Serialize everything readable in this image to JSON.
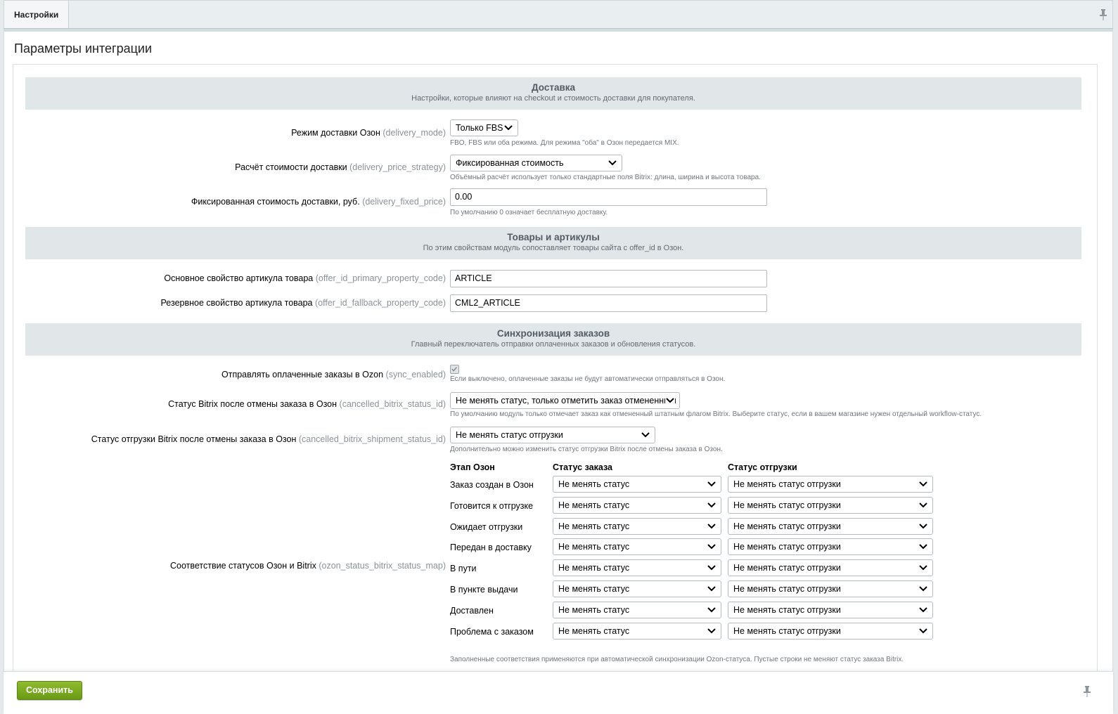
{
  "tabs": {
    "settings": "Настройки"
  },
  "page_title": "Параметры интеграции",
  "sections": {
    "delivery": {
      "title": "Доставка",
      "subtitle": "Настройки, которые влияют на checkout и стоимость доставки для покупателя."
    },
    "products": {
      "title": "Товары и артикулы",
      "subtitle": "По этим свойствам модуль сопоставляет товары сайта с offer_id в Озон."
    },
    "orders": {
      "title": "Синхронизация заказов",
      "subtitle": "Главный переключатель отправки оплаченных заказов и обновления статусов."
    }
  },
  "fields": {
    "delivery_mode": {
      "label": "Режим доставки Озон",
      "code": "(delivery_mode)",
      "value": "Только FBS",
      "hint": "FBO, FBS или оба режима. Для режима \"оба\" в Озон передается MIX."
    },
    "delivery_price_strategy": {
      "label": "Расчёт стоимости доставки",
      "code": "(delivery_price_strategy)",
      "value": "Фиксированная стоимость",
      "hint": "Объёмный расчёт использует только стандартные поля Bitrix: длина, ширина и высота товара."
    },
    "delivery_fixed_price": {
      "label": "Фиксированная стоимость доставки, руб.",
      "code": "(delivery_fixed_price)",
      "value": "0.00",
      "hint": "По умолчанию 0 означает бесплатную доставку."
    },
    "offer_id_primary_property_code": {
      "label": "Основное свойство артикула товара",
      "code": "(offer_id_primary_property_code)",
      "value": "ARTICLE"
    },
    "offer_id_fallback_property_code": {
      "label": "Резервное свойство артикула товара",
      "code": "(offer_id_fallback_property_code)",
      "value": "CML2_ARTICLE"
    },
    "sync_enabled": {
      "label": "Отправлять оплаченные заказы в Ozon",
      "code": "(sync_enabled)",
      "checked": true,
      "hint": "Если выключено, оплаченные заказы не будут автоматически отправляться в Озон."
    },
    "cancelled_bitrix_status_id": {
      "label": "Статус Bitrix после отмены заказа в Озон",
      "code": "(cancelled_bitrix_status_id)",
      "value": "Не менять статус, только отметить заказ отмененным",
      "hint": "По умолчанию модуль только отмечает заказ как отмененный штатным флагом Bitrix. Выберите статус, если в вашем магазине нужен отдельный workflow-статус."
    },
    "cancelled_bitrix_shipment_status_id": {
      "label": "Статус отгрузки Bitrix после отмены заказа в Озон",
      "code": "(cancelled_bitrix_shipment_status_id)",
      "value": "Не менять статус отгрузки",
      "hint": "Дополнительно можно изменить статус отгрузки Bitrix после отмены заказа в Озон."
    },
    "ozon_status_bitrix_status_map": {
      "label": "Соответствие статусов Озон и Bitrix",
      "code": "(ozon_status_bitrix_status_map)",
      "hint": "Заполненные соответствия применяются при автоматической синхронизации Ozon-статуса. Пустые строки не меняют статус заказа Bitrix."
    }
  },
  "status_map": {
    "headers": {
      "stage": "Этап Озон",
      "order_status": "Статус заказа",
      "shipment_status": "Статус отгрузки"
    },
    "rows": [
      {
        "stage": "Заказ создан в Озон",
        "order_status": "Не менять статус",
        "shipment_status": "Не менять статус отгрузки"
      },
      {
        "stage": "Готовится к отгрузке",
        "order_status": "Не менять статус",
        "shipment_status": "Не менять статус отгрузки"
      },
      {
        "stage": "Ожидает отгрузки",
        "order_status": "Не менять статус",
        "shipment_status": "Не менять статус отгрузки"
      },
      {
        "stage": "Передан в доставку",
        "order_status": "Не менять статус",
        "shipment_status": "Не менять статус отгрузки"
      },
      {
        "stage": "В пути",
        "order_status": "Не менять статус",
        "shipment_status": "Не менять статус отгрузки"
      },
      {
        "stage": "В пункте выдачи",
        "order_status": "Не менять статус",
        "shipment_status": "Не менять статус отгрузки"
      },
      {
        "stage": "Доставлен",
        "order_status": "Не менять статус",
        "shipment_status": "Не менять статус отгрузки"
      },
      {
        "stage": "Проблема с заказом",
        "order_status": "Не менять статус",
        "shipment_status": "Не менять статус отгрузки"
      }
    ]
  },
  "footer": {
    "save_label": "Сохранить"
  },
  "icons": {
    "pin": "pin-icon",
    "chevron": "chevron-down-icon",
    "check": "check-icon"
  },
  "colors": {
    "save_button": "#7aa91f",
    "section_bg": "#e1e6e8",
    "code_text": "#8a9398"
  }
}
